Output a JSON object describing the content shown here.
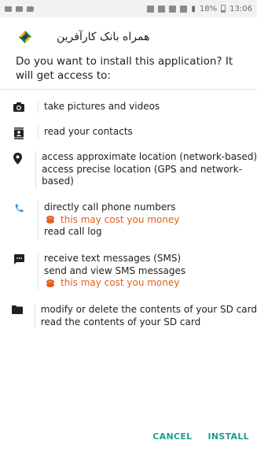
{
  "status_bar": {
    "battery": "18%",
    "time": "13:06"
  },
  "header": {
    "app_name": "همراه بانک کارآفرین"
  },
  "prompt": "Do you want to install this application? It will get access to:",
  "permissions": [
    {
      "icon": "camera-icon",
      "lines": [
        {
          "text": "take pictures and videos"
        }
      ]
    },
    {
      "icon": "contacts-icon",
      "lines": [
        {
          "text": "read your contacts"
        }
      ]
    },
    {
      "icon": "location-icon",
      "lines": [
        {
          "text": "access approximate location (network-based)"
        },
        {
          "text": "access precise location (GPS and network-"
        },
        {
          "text": "based)"
        }
      ]
    },
    {
      "icon": "phone-icon",
      "lines": [
        {
          "text": "directly call phone numbers"
        },
        {
          "text": "this may cost you money",
          "cost": true
        },
        {
          "text": "read call log"
        }
      ]
    },
    {
      "icon": "message-icon",
      "lines": [
        {
          "text": "receive text messages (SMS)"
        },
        {
          "text": "send and view SMS messages"
        },
        {
          "text": "this may cost you money",
          "cost": true
        }
      ]
    },
    {
      "icon": "folder-icon",
      "lines": [
        {
          "text": "modify or delete the contents of your SD card"
        },
        {
          "text": "read the contents of your SD card"
        }
      ]
    }
  ],
  "actions": {
    "cancel": "CANCEL",
    "install": "INSTALL"
  },
  "colors": {
    "accent": "#1b9e8e",
    "warning": "#e0601e",
    "text": "#212121"
  }
}
